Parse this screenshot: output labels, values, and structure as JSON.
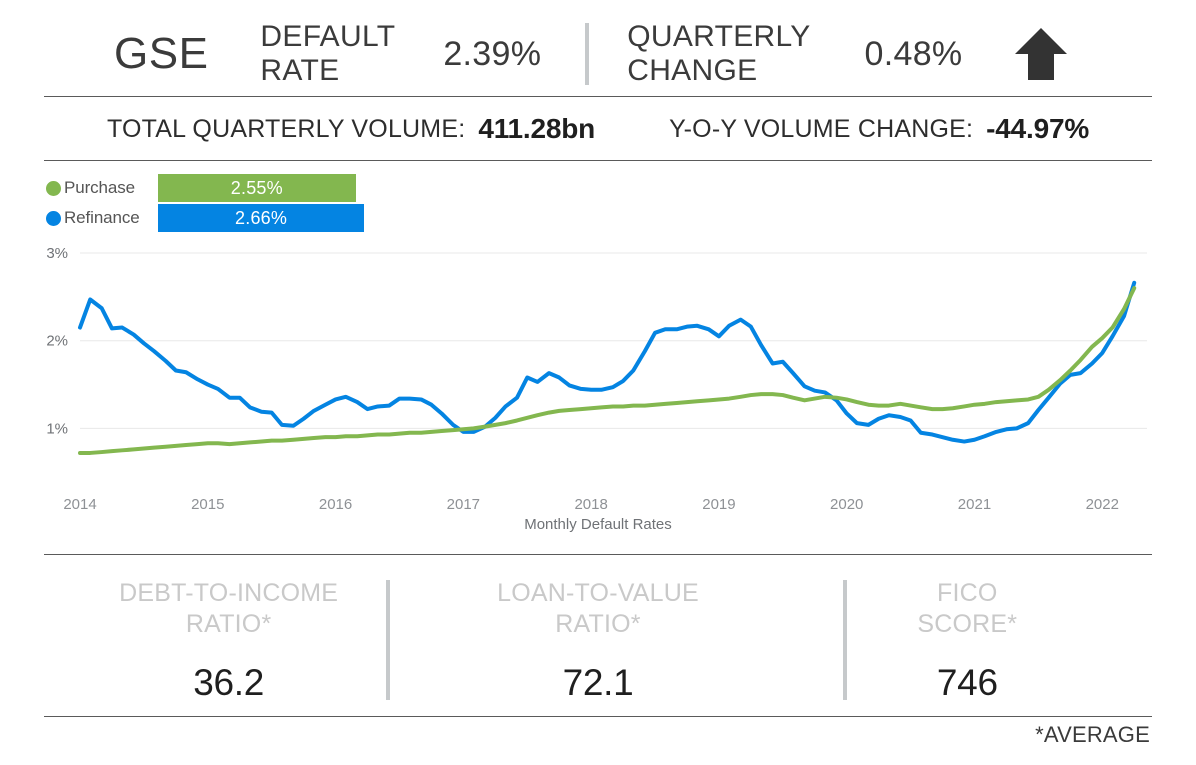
{
  "header": {
    "title": "GSE",
    "default_rate_label": "DEFAULT\nRATE",
    "default_rate_value": "2.39%",
    "quarterly_change_label": "QUARTERLY\nCHANGE",
    "quarterly_change_value": "0.48%",
    "trend_icon": "arrow-up-icon",
    "trend_direction": "up",
    "trend_color": "#333333"
  },
  "volume": {
    "total_label": "TOTAL QUARTERLY VOLUME:",
    "total_value": "411.28bn",
    "yoy_label": "Y-O-Y VOLUME CHANGE:",
    "yoy_value": "-44.97%"
  },
  "legend": {
    "purchase_label": "Purchase",
    "purchase_value": "2.55%",
    "purchase_color": "#83b74f",
    "refinance_label": "Refinance",
    "refinance_value": "2.66%",
    "refinance_color": "#0484e2"
  },
  "chart_data": {
    "type": "line",
    "title": "",
    "xlabel": "Monthly Default Rates",
    "ylabel": "",
    "ylim": [
      0.4,
      3.0
    ],
    "yticks": [
      1,
      2,
      3
    ],
    "ytick_labels": [
      "1%",
      "2%",
      "3%"
    ],
    "xlim": [
      2014.0,
      2022.35
    ],
    "xticks": [
      2014,
      2015,
      2016,
      2017,
      2018,
      2019,
      2020,
      2021,
      2022
    ],
    "xtick_labels": [
      "2014",
      "2015",
      "2016",
      "2017",
      "2018",
      "2019",
      "2020",
      "2021",
      "2022"
    ],
    "grid": "horizontal",
    "legend_position": "top-left",
    "series": [
      {
        "name": "Refinance",
        "color": "#0484e2",
        "x": [
          2014.0,
          2014.08,
          2014.17,
          2014.25,
          2014.33,
          2014.42,
          2014.5,
          2014.58,
          2014.67,
          2014.75,
          2014.83,
          2014.92,
          2015.0,
          2015.08,
          2015.17,
          2015.25,
          2015.33,
          2015.42,
          2015.5,
          2015.58,
          2015.67,
          2015.75,
          2015.83,
          2015.92,
          2016.0,
          2016.08,
          2016.17,
          2016.25,
          2016.33,
          2016.42,
          2016.5,
          2016.58,
          2016.67,
          2016.75,
          2016.83,
          2016.92,
          2017.0,
          2017.08,
          2017.17,
          2017.25,
          2017.33,
          2017.42,
          2017.5,
          2017.58,
          2017.67,
          2017.75,
          2017.83,
          2017.92,
          2018.0,
          2018.08,
          2018.17,
          2018.25,
          2018.33,
          2018.42,
          2018.5,
          2018.58,
          2018.67,
          2018.75,
          2018.83,
          2018.92,
          2019.0,
          2019.08,
          2019.17,
          2019.25,
          2019.33,
          2019.42,
          2019.5,
          2019.58,
          2019.67,
          2019.75,
          2019.83,
          2019.92,
          2020.0,
          2020.08,
          2020.17,
          2020.25,
          2020.33,
          2020.42,
          2020.5,
          2020.58,
          2020.67,
          2020.75,
          2020.83,
          2020.92,
          2021.0,
          2021.08,
          2021.17,
          2021.25,
          2021.33,
          2021.42,
          2021.5,
          2021.58,
          2021.67,
          2021.75,
          2021.83,
          2021.92,
          2022.0,
          2022.08,
          2022.17,
          2022.25
        ],
        "values": [
          2.15,
          2.47,
          2.37,
          2.14,
          2.15,
          2.07,
          1.97,
          1.88,
          1.77,
          1.66,
          1.64,
          1.56,
          1.5,
          1.45,
          1.35,
          1.35,
          1.24,
          1.19,
          1.18,
          1.04,
          1.03,
          1.11,
          1.2,
          1.27,
          1.33,
          1.36,
          1.3,
          1.22,
          1.25,
          1.26,
          1.34,
          1.34,
          1.33,
          1.27,
          1.17,
          1.04,
          0.96,
          0.96,
          1.02,
          1.12,
          1.25,
          1.35,
          1.58,
          1.53,
          1.63,
          1.58,
          1.49,
          1.45,
          1.44,
          1.44,
          1.47,
          1.54,
          1.66,
          1.88,
          2.09,
          2.13,
          2.13,
          2.16,
          2.17,
          2.13,
          2.05,
          2.17,
          2.24,
          2.16,
          1.95,
          1.74,
          1.76,
          1.63,
          1.48,
          1.43,
          1.41,
          1.32,
          1.17,
          1.06,
          1.04,
          1.11,
          1.15,
          1.13,
          1.09,
          0.95,
          0.93,
          0.9,
          0.87,
          0.85,
          0.87,
          0.91,
          0.96,
          0.99,
          1.0,
          1.06,
          1.21,
          1.35,
          1.51,
          1.61,
          1.63,
          1.74,
          1.86,
          2.05,
          2.28,
          2.66
        ]
      },
      {
        "name": "Purchase",
        "color": "#83b74f",
        "x": [
          2014.0,
          2014.08,
          2014.17,
          2014.25,
          2014.33,
          2014.42,
          2014.5,
          2014.58,
          2014.67,
          2014.75,
          2014.83,
          2014.92,
          2015.0,
          2015.08,
          2015.17,
          2015.25,
          2015.33,
          2015.42,
          2015.5,
          2015.58,
          2015.67,
          2015.75,
          2015.83,
          2015.92,
          2016.0,
          2016.08,
          2016.17,
          2016.25,
          2016.33,
          2016.42,
          2016.5,
          2016.58,
          2016.67,
          2016.75,
          2016.83,
          2016.92,
          2017.0,
          2017.08,
          2017.17,
          2017.25,
          2017.33,
          2017.42,
          2017.5,
          2017.58,
          2017.67,
          2017.75,
          2017.83,
          2017.92,
          2018.0,
          2018.08,
          2018.17,
          2018.25,
          2018.33,
          2018.42,
          2018.5,
          2018.58,
          2018.67,
          2018.75,
          2018.83,
          2018.92,
          2019.0,
          2019.08,
          2019.17,
          2019.25,
          2019.33,
          2019.42,
          2019.5,
          2019.58,
          2019.67,
          2019.75,
          2019.83,
          2019.92,
          2020.0,
          2020.08,
          2020.17,
          2020.25,
          2020.33,
          2020.42,
          2020.5,
          2020.58,
          2020.67,
          2020.75,
          2020.83,
          2020.92,
          2021.0,
          2021.08,
          2021.17,
          2021.25,
          2021.33,
          2021.42,
          2021.5,
          2021.58,
          2021.67,
          2021.75,
          2021.83,
          2021.92,
          2022.0,
          2022.08,
          2022.17,
          2022.25
        ],
        "values": [
          0.72,
          0.72,
          0.73,
          0.74,
          0.75,
          0.76,
          0.77,
          0.78,
          0.79,
          0.8,
          0.81,
          0.82,
          0.83,
          0.83,
          0.82,
          0.83,
          0.84,
          0.85,
          0.86,
          0.86,
          0.87,
          0.88,
          0.89,
          0.9,
          0.9,
          0.91,
          0.91,
          0.92,
          0.93,
          0.93,
          0.94,
          0.95,
          0.95,
          0.96,
          0.97,
          0.98,
          0.99,
          1.0,
          1.02,
          1.04,
          1.06,
          1.09,
          1.12,
          1.15,
          1.18,
          1.2,
          1.21,
          1.22,
          1.23,
          1.24,
          1.25,
          1.25,
          1.26,
          1.26,
          1.27,
          1.28,
          1.29,
          1.3,
          1.31,
          1.32,
          1.33,
          1.34,
          1.36,
          1.38,
          1.39,
          1.39,
          1.38,
          1.35,
          1.32,
          1.34,
          1.36,
          1.35,
          1.33,
          1.3,
          1.27,
          1.26,
          1.26,
          1.28,
          1.26,
          1.24,
          1.22,
          1.22,
          1.23,
          1.25,
          1.27,
          1.28,
          1.3,
          1.31,
          1.32,
          1.33,
          1.36,
          1.44,
          1.55,
          1.66,
          1.78,
          1.93,
          2.03,
          2.15,
          2.36,
          2.6
        ]
      }
    ]
  },
  "stats": {
    "items": [
      {
        "label": "DEBT-TO-INCOME\nRATIO*",
        "value": "36.2"
      },
      {
        "label": "LOAN-TO-VALUE\nRATIO*",
        "value": "72.1"
      },
      {
        "label": "FICO\nSCORE*",
        "value": "746"
      }
    ]
  },
  "footnote": "*AVERAGE"
}
